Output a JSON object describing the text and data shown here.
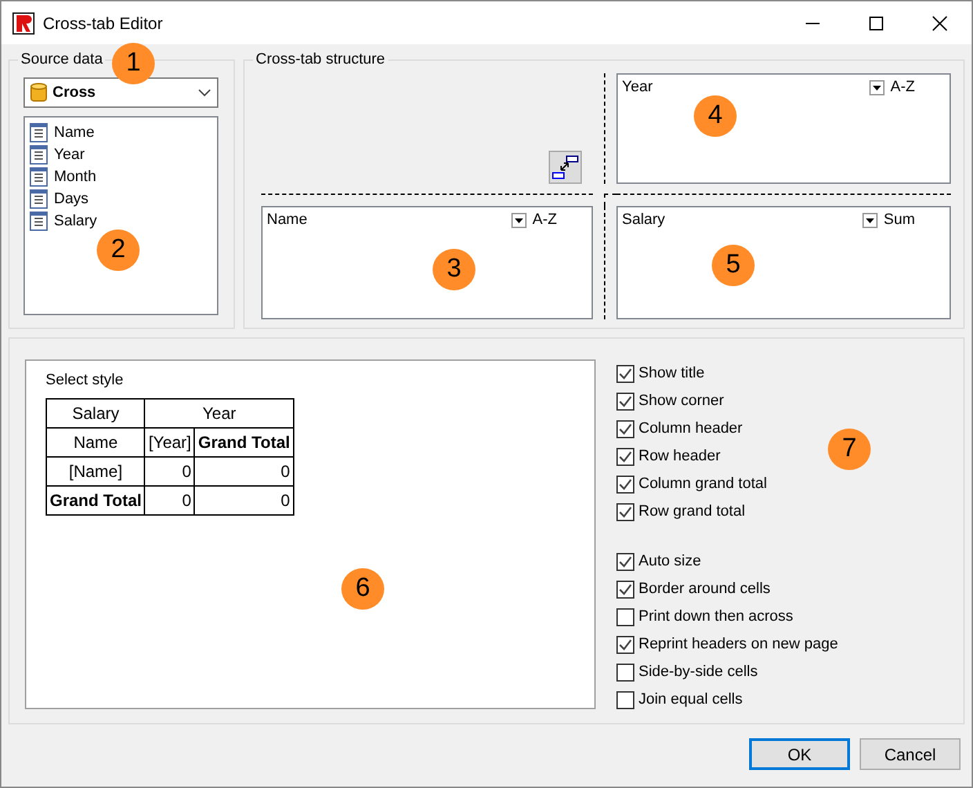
{
  "window": {
    "title": "Cross-tab Editor"
  },
  "source_data": {
    "label": "Source data",
    "datasource": "Cross",
    "fields": [
      "Name",
      "Year",
      "Month",
      "Days",
      "Salary"
    ]
  },
  "structure": {
    "label": "Cross-tab structure",
    "column_area": {
      "field": "Year",
      "option": "A-Z"
    },
    "row_area": {
      "field": "Name",
      "option": "A-Z"
    },
    "cell_area": {
      "field": "Salary",
      "option": "Sum"
    }
  },
  "style_preview": {
    "label": "Select style",
    "rows": [
      [
        {
          "text": "Salary",
          "bold": false
        },
        {
          "text": "Year",
          "bold": false,
          "colspan": 2
        }
      ],
      [
        {
          "text": "Name",
          "bold": false
        },
        {
          "text": "[Year]",
          "bold": false
        },
        {
          "text": "Grand Total",
          "bold": true
        }
      ],
      [
        {
          "text": "[Name]",
          "bold": false
        },
        {
          "text": "0",
          "bold": false
        },
        {
          "text": "0",
          "bold": false
        }
      ],
      [
        {
          "text": "Grand Total",
          "bold": true
        },
        {
          "text": "0",
          "bold": false
        },
        {
          "text": "0",
          "bold": false
        }
      ]
    ]
  },
  "option_groups": [
    [
      {
        "label": "Show title",
        "checked": true
      },
      {
        "label": "Show corner",
        "checked": true
      },
      {
        "label": "Column header",
        "checked": true
      },
      {
        "label": "Row header",
        "checked": true
      },
      {
        "label": "Column grand total",
        "checked": true
      },
      {
        "label": "Row grand total",
        "checked": true
      }
    ],
    [
      {
        "label": "Auto size",
        "checked": true
      },
      {
        "label": "Border around cells",
        "checked": true
      },
      {
        "label": "Print down then across",
        "checked": false
      },
      {
        "label": "Reprint headers on new page",
        "checked": true
      },
      {
        "label": "Side-by-side cells",
        "checked": false
      },
      {
        "label": "Join equal cells",
        "checked": false
      }
    ]
  ],
  "buttons": [
    {
      "label": "OK",
      "selected": true
    },
    {
      "label": "Cancel",
      "selected": false
    }
  ],
  "callouts": [
    "1",
    "2",
    "3",
    "4",
    "5",
    "6",
    "7"
  ]
}
